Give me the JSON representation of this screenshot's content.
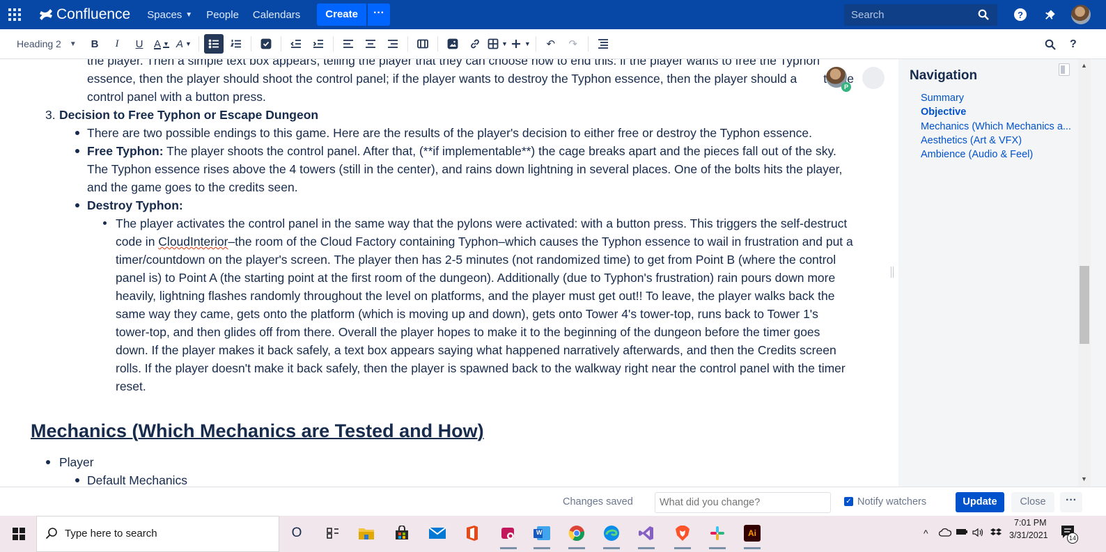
{
  "topbar": {
    "app_name": "Confluence",
    "nav": [
      {
        "label": "Spaces",
        "has_dropdown": true
      },
      {
        "label": "People"
      },
      {
        "label": "Calendars"
      }
    ],
    "create_label": "Create",
    "more_label": "···",
    "search_placeholder": "Search",
    "help_glyph": "?",
    "icons": [
      "app-switcher-icon",
      "confluence-logo-icon",
      "search-icon",
      "help-icon",
      "notification-icon",
      "profile-avatar"
    ]
  },
  "toolbar": {
    "text_style": "Heading 2",
    "items": [
      "bold",
      "italic",
      "underline",
      "text-color",
      "text-formatting",
      "bullet-list",
      "numbered-list",
      "task-list",
      "outdent",
      "indent",
      "align-left",
      "align-center",
      "align-right",
      "page-layout",
      "image",
      "link",
      "table",
      "insert-more",
      "undo",
      "redo",
      "table-of-contents"
    ],
    "glyphs": {
      "bold": "B",
      "italic": "I",
      "underline": "U",
      "text_color": "A",
      "undo": "↶",
      "redo": "↷"
    },
    "right_icons": [
      "find-replace-icon",
      "keyboard-shortcuts-icon"
    ],
    "help_glyph": "?"
  },
  "content": {
    "line1_top": "the player. Then a simple text box appears, telling the player that they can choose how to end this: if the player wants to free the Typhon",
    "line1_a": "essence, then the player should shoot the control panel; if the player wants to destroy the Typhon essence, then the player should a",
    "line1_b": "te the",
    "line1_c": "control panel with a button press.",
    "item3_number": "3.",
    "item3_heading": "Decision to Free Typhon or Escape Dungeon",
    "endings_intro": "There are two possible endings to this game. Here are the results of the player's decision to either free or destroy the Typhon essence.",
    "free_label": "Free Typhon:",
    "free_l1": " The player shoots the control panel. After that, (**if implementable**) the cage breaks apart and the pieces fall out of the sky.",
    "free_l2": "The Typhon essence rises above the 4 towers (still in the center), and rains down lightning in several places. One of the bolts hits the player,",
    "free_l3": "and the game goes to the credits seen.",
    "destroy_label": "Destroy Typhon:",
    "destroy_lines": [
      "The player activates the control panel in the same way that the pylons were activated: with a button press. This triggers the self-destruct",
      "–the room of the Cloud Factory containing Typhon–which causes the Typhon essence to wail in frustration and put a",
      "timer/countdown on the player's screen. The player then has 2-5 minutes (not randomized time) to get from Point B (where the control",
      "panel is) to Point A (the starting point at the first room of the dungeon). Additionally (due to Typhon's frustration) rain pours down more",
      "heavily, lightning flashes randomly throughout the level on platforms, and the player must get out!! To leave, the player walks back the",
      "same way they came, gets onto the platform (which is moving up and down), gets onto Tower 4's tower-top, runs back to Tower 1's",
      "tower-top, and then glides off from there. Overall the player hopes to make it to the beginning of the dungeon before the timer goes",
      "down. If the player makes it back safely, a text box appears saying what happened narratively afterwards, and then the Credits screen",
      "rolls. If the player doesn't make it back safely, then the player is spawned back to the walkway right near the control panel with the timer",
      "reset."
    ],
    "destroy_l2_prefix": "code in ",
    "misspelled_word": "CloudInterior",
    "mechanics_heading": "Mechanics (Which Mechanics are Tested and How)",
    "player_item": "Player",
    "default_mechanics_item": "Default Mechanics",
    "collaborator_badge": "P"
  },
  "sidebar": {
    "title": "Navigation",
    "items": [
      {
        "label": "Summary",
        "active": false
      },
      {
        "label": "Objective",
        "active": true
      },
      {
        "label": "Mechanics (Which Mechanics a...",
        "active": false
      },
      {
        "label": "Aesthetics (Art & VFX)",
        "active": false
      },
      {
        "label": "Ambience (Audio & Feel)",
        "active": false
      }
    ],
    "scroll_position_fraction": 0.53
  },
  "bottombar": {
    "status": "Changes saved",
    "change_placeholder": "What did you change?",
    "notify_label": "Notify watchers",
    "notify_checked": true,
    "check_glyph": "✓",
    "update_label": "Update",
    "close_label": "Close",
    "more_label": "···"
  },
  "taskbar": {
    "search_placeholder": "Type here to search",
    "cortana_glyph": "O",
    "apps": [
      "cortana-icon",
      "task-view-icon",
      "file-explorer-icon",
      "microsoft-store-icon",
      "mail-icon",
      "office-icon",
      "snip-sketch-icon",
      "word-icon",
      "chrome-icon",
      "edge-icon",
      "visual-studio-icon",
      "brave-icon",
      "slack-icon",
      "illustrator-icon"
    ],
    "word_glyph": "W",
    "illustrator_glyph": "Ai",
    "tray_chevron": "^",
    "time": "7:01 PM",
    "date": "3/31/2021",
    "notification_count": "14",
    "colors": {
      "accent": "#0052cc",
      "topbar": "#0747a6",
      "taskbar": "#f0e6ec"
    }
  }
}
